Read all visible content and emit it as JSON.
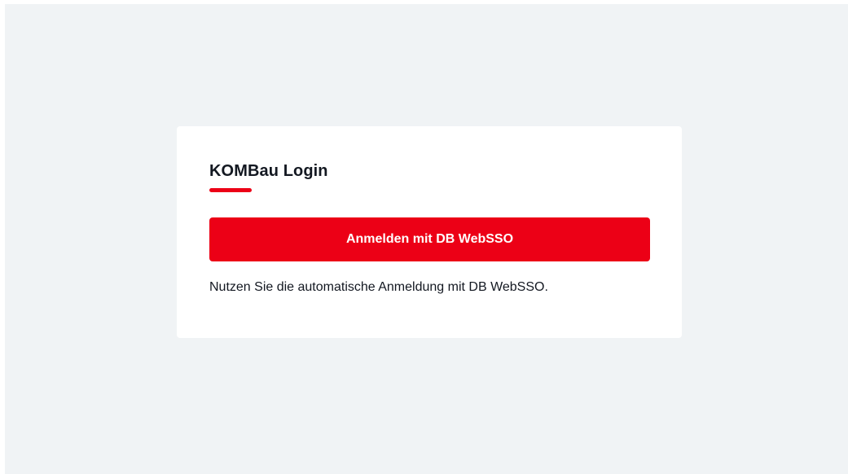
{
  "login": {
    "title": "KOMBau Login",
    "button_label": "Anmelden mit DB WebSSO",
    "hint": "Nutzen Sie die automatische Anmeldung mit DB WebSSO."
  },
  "colors": {
    "accent": "#ec0016",
    "page_background": "#f0f3f5",
    "card_background": "#ffffff",
    "text": "#131821"
  }
}
